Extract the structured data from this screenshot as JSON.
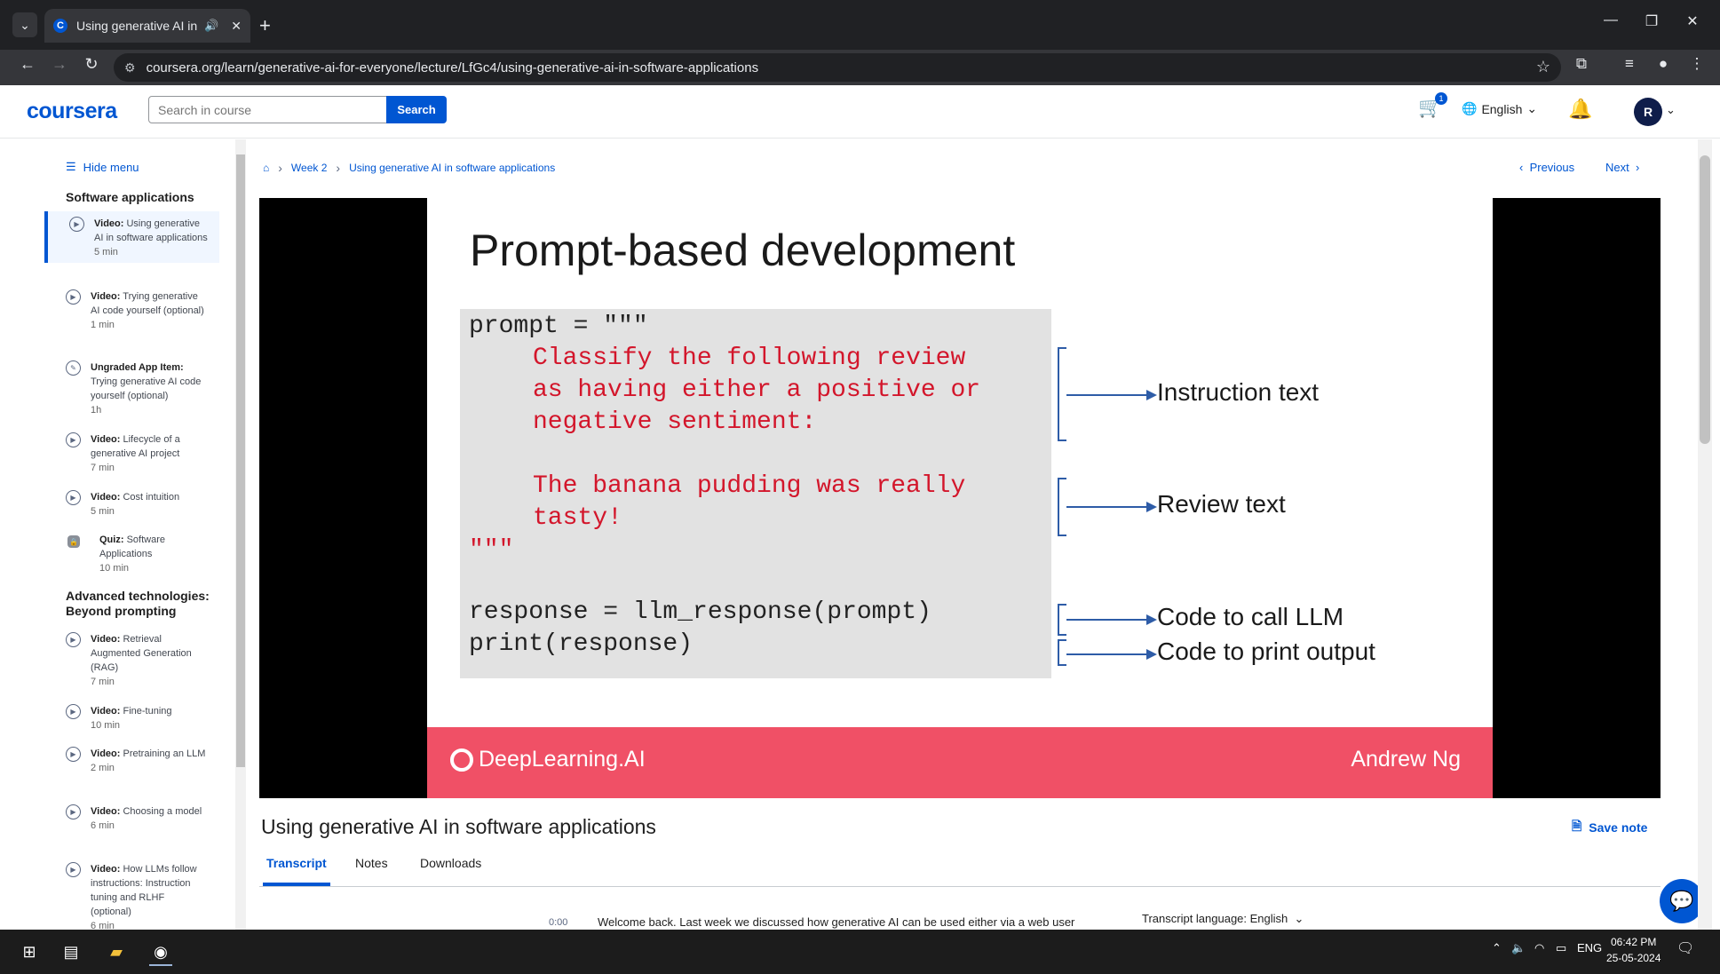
{
  "browser": {
    "tab_title": "Using generative AI in softw",
    "url": "coursera.org/learn/generative-ai-for-everyone/lecture/LfGc4/using-generative-ai-in-software-applications"
  },
  "header": {
    "logo": "coursera",
    "search_placeholder": "Search in course",
    "search_button": "Search",
    "cart_count": "1",
    "language": "English",
    "avatar_initial": "R"
  },
  "sidebar": {
    "hide_menu": "Hide menu",
    "section1": "Software applications",
    "items": [
      {
        "type": "Video:",
        "label": "Using generative AI in software applications",
        "time": "5 min"
      },
      {
        "type": "Video:",
        "label": "Trying generative AI code yourself (optional)",
        "time": "1 min"
      },
      {
        "type": "Ungraded App Item:",
        "label": "Trying generative AI code yourself (optional)",
        "time": "1h"
      },
      {
        "type": "Video:",
        "label": "Lifecycle of a generative AI project",
        "time": "7 min"
      },
      {
        "type": "Video:",
        "label": "Cost intuition",
        "time": "5 min"
      },
      {
        "type": "Quiz:",
        "label": "Software Applications",
        "time": "10 min"
      }
    ],
    "section2": "Advanced technologies: Beyond prompting",
    "items2": [
      {
        "type": "Video:",
        "label": "Retrieval Augmented Generation (RAG)",
        "time": "7 min"
      },
      {
        "type": "Video:",
        "label": "Fine-tuning",
        "time": "10 min"
      },
      {
        "type": "Video:",
        "label": "Pretraining an LLM",
        "time": "2 min"
      },
      {
        "type": "Video:",
        "label": "Choosing a model",
        "time": "6 min"
      },
      {
        "type": "Video:",
        "label": "How LLMs follow instructions: Instruction tuning and RLHF (optional)",
        "time": "6 min"
      }
    ]
  },
  "breadcrumb": {
    "week": "Week 2",
    "lecture": "Using generative AI in software applications"
  },
  "nav": {
    "previous": "Previous",
    "next": "Next"
  },
  "slide": {
    "title": "Prompt-based development",
    "code_line1": "prompt = \"\"\"",
    "code_instr": "Classify the following review\nas having either a positive or\nnegative sentiment:",
    "code_review": "The banana pudding was really\ntasty!",
    "code_close": "\"\"\"",
    "code_response": "response = llm_response(prompt)\nprint(response)",
    "annot_instruction": "Instruction text",
    "annot_review": "Review text",
    "annot_call": "Code to call LLM",
    "annot_print": "Code to print output",
    "brand": "DeepLearning.AI",
    "author": "Andrew Ng"
  },
  "lecture": {
    "title": "Using generative AI in software applications",
    "save_note": "Save note",
    "tabs": [
      "Transcript",
      "Notes",
      "Downloads"
    ],
    "timestamp": "0:00",
    "transcript_line": "Welcome back. Last week we discussed how generative AI can be used either via a web user",
    "transcript_language": "Transcript language: English"
  },
  "taskbar": {
    "lang": "ENG",
    "time": "06:42 PM",
    "date": "25-05-2024"
  }
}
